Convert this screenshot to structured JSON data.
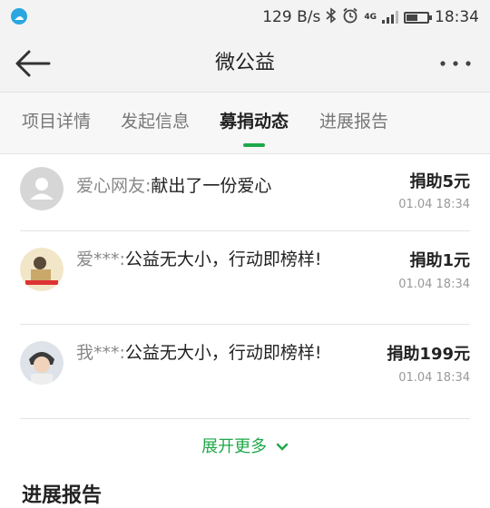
{
  "status_bar": {
    "app_icon": "cloud-app-icon",
    "network_speed": "129 B/s",
    "bluetooth_icon": "bluetooth-icon",
    "alarm_icon": "alarm-icon",
    "network_type": "4G",
    "battery_level": 0.55,
    "time": "18:34"
  },
  "header": {
    "title": "微公益",
    "back_icon": "arrow-left-icon",
    "more_icon": "more-dots-icon"
  },
  "tabs": [
    {
      "label": "项目详情",
      "active": false
    },
    {
      "label": "发起信息",
      "active": false
    },
    {
      "label": "募捐动态",
      "active": true
    },
    {
      "label": "进展报告",
      "active": false
    }
  ],
  "donations": [
    {
      "name": "爱心网友:",
      "message": "献出了一份爱心",
      "amount": "捐助5元",
      "time": "01.04 18:34",
      "avatar": "default-user-avatar"
    },
    {
      "name": "爱***:",
      "message": "公益无大小，行动即榜样!",
      "amount": "捐助1元",
      "time": "01.04 18:34",
      "avatar": "user-photo-avatar"
    },
    {
      "name": "我***:",
      "message": "公益无大小，行动即榜样!",
      "amount": "捐助199元",
      "time": "01.04 18:34",
      "avatar": "user-photo-avatar"
    }
  ],
  "expand_more": "展开更多",
  "expand_icon": "chevron-down-icon",
  "next_section_title": "进展报告",
  "colors": {
    "accent": "#1fa84a",
    "header_bg": "#f3f3f3",
    "tab_bg": "#f7f7f7"
  }
}
